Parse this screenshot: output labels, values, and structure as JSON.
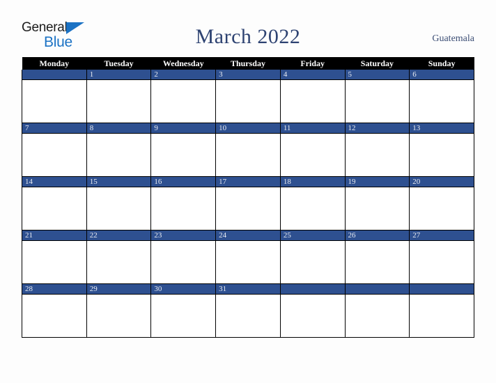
{
  "brand": {
    "name_part1": "General",
    "name_part2": "Blue",
    "triangle_icon": "blue-triangle-icon"
  },
  "header": {
    "title": "March 2022",
    "country": "Guatemala"
  },
  "calendar": {
    "month": "March",
    "year": "2022",
    "weekday_headers": [
      "Monday",
      "Tuesday",
      "Wednesday",
      "Thursday",
      "Friday",
      "Saturday",
      "Sunday"
    ],
    "colors": {
      "header_background": "#000000",
      "header_text": "#ffffff",
      "day_band": "#2e5090",
      "day_number_text": "#e9ecf3",
      "cell_background": "#ffffff",
      "grid_border": "#000000",
      "title_text": "#2e4372",
      "page_background": "#fdfdfd",
      "brand_blue": "#1b72c4"
    },
    "weeks": [
      [
        "",
        "1",
        "2",
        "3",
        "4",
        "5",
        "6"
      ],
      [
        "7",
        "8",
        "9",
        "10",
        "11",
        "12",
        "13"
      ],
      [
        "14",
        "15",
        "16",
        "17",
        "18",
        "19",
        "20"
      ],
      [
        "21",
        "22",
        "23",
        "24",
        "25",
        "26",
        "27"
      ],
      [
        "28",
        "29",
        "30",
        "31",
        "",
        "",
        ""
      ]
    ]
  }
}
